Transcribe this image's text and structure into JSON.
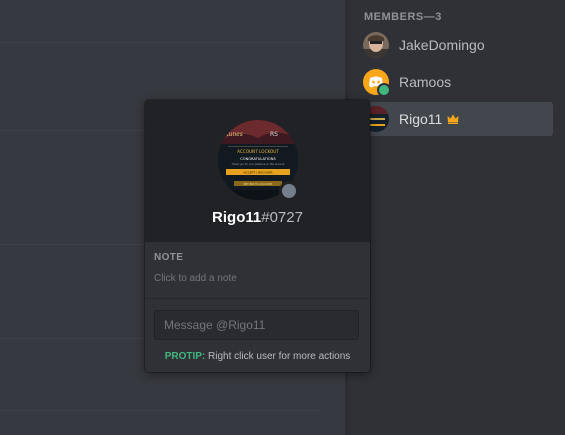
{
  "members_list": {
    "header": "MEMBERS—3",
    "members": [
      {
        "name": "JakeDomingo",
        "status": ""
      },
      {
        "name": "Ramoos",
        "status": "online"
      },
      {
        "name": "Rigo11",
        "status": "",
        "badge": "crown-icon"
      }
    ],
    "accent_crown": "#faa61a",
    "online_color": "#43b581"
  },
  "popout": {
    "username": "Rigo11",
    "discriminator": "#0727",
    "avatar_lines": [
      "ACCOUNT LOCKOUT",
      "CONGRATULATIONS",
      "Thank you for your patience on this account",
      "ACCEPT / RECOVER",
      "RETURN TO ACCOUNT"
    ],
    "note_label": "NOTE",
    "note_placeholder": "Click to add a note",
    "message_placeholder": "Message @Rigo11",
    "protip_label": "PROTIP:",
    "protip_text": "Right click user for more actions"
  }
}
